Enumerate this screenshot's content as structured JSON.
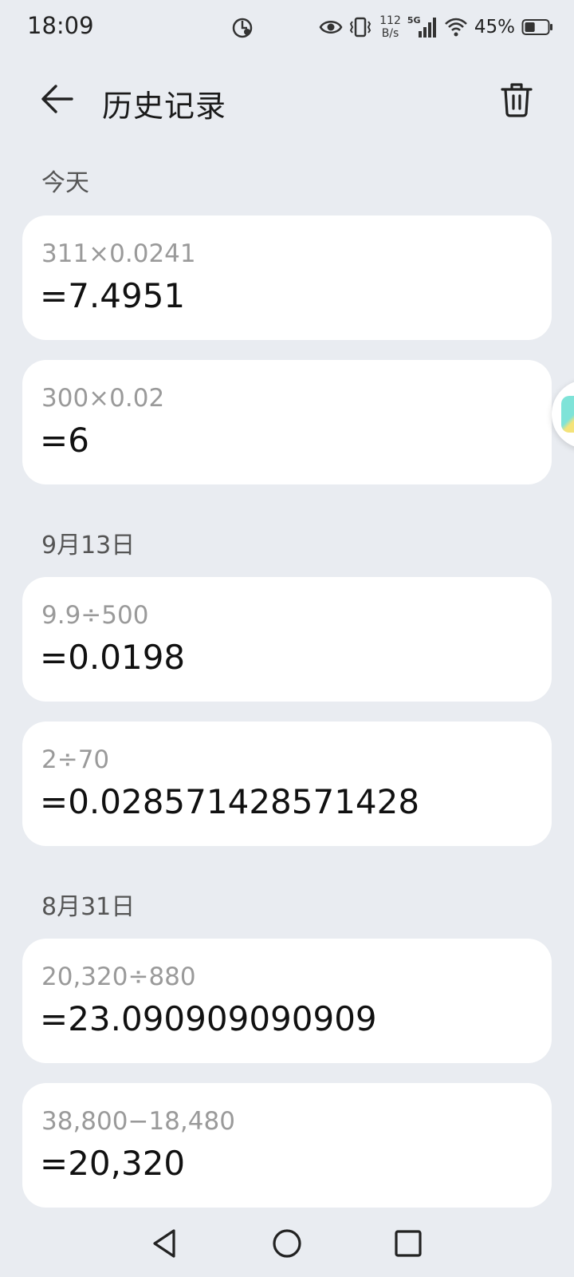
{
  "status_bar": {
    "time": "18:09",
    "net_speed_value": "112",
    "net_speed_unit": "B/s",
    "network_type": "5G",
    "battery_percent": "45%",
    "battery_level": 0.45
  },
  "app_bar": {
    "title": "历史记录",
    "back_icon": "arrow-left-icon",
    "delete_icon": "trash-icon"
  },
  "sections": [
    {
      "date": "今天",
      "entries": [
        {
          "expression": "311×0.0241",
          "result": "=7.4951"
        },
        {
          "expression": "300×0.02",
          "result": "=6"
        }
      ]
    },
    {
      "date": "9月13日",
      "entries": [
        {
          "expression": "9.9÷500",
          "result": "=0.0198"
        },
        {
          "expression": "2÷70",
          "result": "=0.028571428571428"
        }
      ]
    },
    {
      "date": "8月31日",
      "entries": [
        {
          "expression": "20,320÷880",
          "result": "=23.090909090909"
        },
        {
          "expression": "38,800−18,480",
          "result": "=20,320"
        }
      ]
    }
  ],
  "nav_bar": {
    "back_icon": "triangle-back-icon",
    "home_icon": "circle-home-icon",
    "recents_icon": "square-recents-icon"
  },
  "colors": {
    "background": "#e9ecf1",
    "card": "#ffffff",
    "expression_text": "#9a9a9a",
    "result_text": "#111111"
  }
}
